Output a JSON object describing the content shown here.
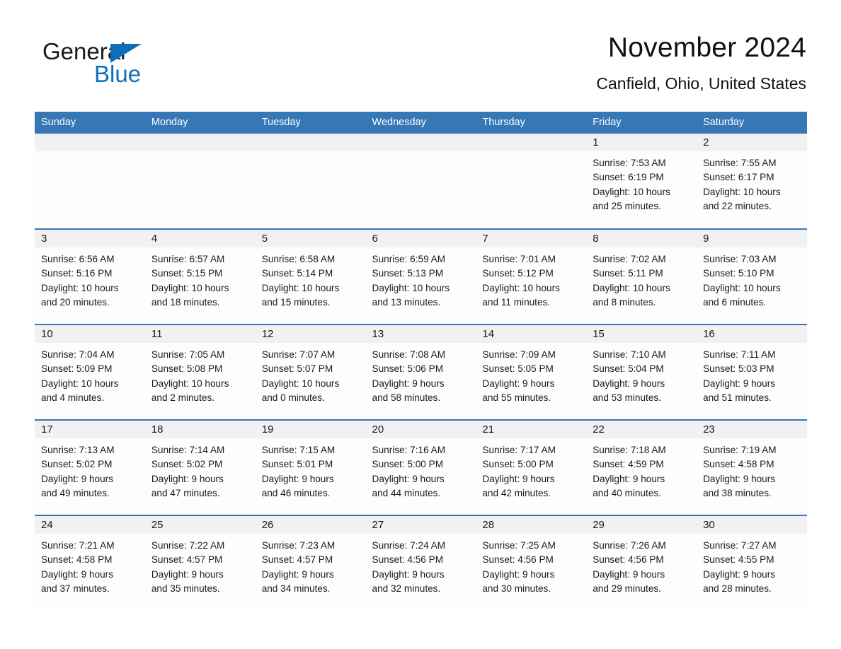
{
  "logo": {
    "word1": "General",
    "word2": "Blue",
    "triangle_color": "#0d6fba"
  },
  "header": {
    "title": "November 2024",
    "subtitle": "Canfield, Ohio, United States"
  },
  "theme": {
    "header_blue": "#3677b5",
    "daynum_band": "#f1f1f1",
    "text": "#1a1a1a"
  },
  "calendar": {
    "weekday_headers": [
      "Sunday",
      "Monday",
      "Tuesday",
      "Wednesday",
      "Thursday",
      "Friday",
      "Saturday"
    ],
    "weeks": [
      [
        {
          "day": "",
          "sunrise": "",
          "sunset": "",
          "daylight_1": "",
          "daylight_2": ""
        },
        {
          "day": "",
          "sunrise": "",
          "sunset": "",
          "daylight_1": "",
          "daylight_2": ""
        },
        {
          "day": "",
          "sunrise": "",
          "sunset": "",
          "daylight_1": "",
          "daylight_2": ""
        },
        {
          "day": "",
          "sunrise": "",
          "sunset": "",
          "daylight_1": "",
          "daylight_2": ""
        },
        {
          "day": "",
          "sunrise": "",
          "sunset": "",
          "daylight_1": "",
          "daylight_2": ""
        },
        {
          "day": "1",
          "sunrise": "Sunrise: 7:53 AM",
          "sunset": "Sunset: 6:19 PM",
          "daylight_1": "Daylight: 10 hours",
          "daylight_2": "and 25 minutes."
        },
        {
          "day": "2",
          "sunrise": "Sunrise: 7:55 AM",
          "sunset": "Sunset: 6:17 PM",
          "daylight_1": "Daylight: 10 hours",
          "daylight_2": "and 22 minutes."
        }
      ],
      [
        {
          "day": "3",
          "sunrise": "Sunrise: 6:56 AM",
          "sunset": "Sunset: 5:16 PM",
          "daylight_1": "Daylight: 10 hours",
          "daylight_2": "and 20 minutes."
        },
        {
          "day": "4",
          "sunrise": "Sunrise: 6:57 AM",
          "sunset": "Sunset: 5:15 PM",
          "daylight_1": "Daylight: 10 hours",
          "daylight_2": "and 18 minutes."
        },
        {
          "day": "5",
          "sunrise": "Sunrise: 6:58 AM",
          "sunset": "Sunset: 5:14 PM",
          "daylight_1": "Daylight: 10 hours",
          "daylight_2": "and 15 minutes."
        },
        {
          "day": "6",
          "sunrise": "Sunrise: 6:59 AM",
          "sunset": "Sunset: 5:13 PM",
          "daylight_1": "Daylight: 10 hours",
          "daylight_2": "and 13 minutes."
        },
        {
          "day": "7",
          "sunrise": "Sunrise: 7:01 AM",
          "sunset": "Sunset: 5:12 PM",
          "daylight_1": "Daylight: 10 hours",
          "daylight_2": "and 11 minutes."
        },
        {
          "day": "8",
          "sunrise": "Sunrise: 7:02 AM",
          "sunset": "Sunset: 5:11 PM",
          "daylight_1": "Daylight: 10 hours",
          "daylight_2": "and 8 minutes."
        },
        {
          "day": "9",
          "sunrise": "Sunrise: 7:03 AM",
          "sunset": "Sunset: 5:10 PM",
          "daylight_1": "Daylight: 10 hours",
          "daylight_2": "and 6 minutes."
        }
      ],
      [
        {
          "day": "10",
          "sunrise": "Sunrise: 7:04 AM",
          "sunset": "Sunset: 5:09 PM",
          "daylight_1": "Daylight: 10 hours",
          "daylight_2": "and 4 minutes."
        },
        {
          "day": "11",
          "sunrise": "Sunrise: 7:05 AM",
          "sunset": "Sunset: 5:08 PM",
          "daylight_1": "Daylight: 10 hours",
          "daylight_2": "and 2 minutes."
        },
        {
          "day": "12",
          "sunrise": "Sunrise: 7:07 AM",
          "sunset": "Sunset: 5:07 PM",
          "daylight_1": "Daylight: 10 hours",
          "daylight_2": "and 0 minutes."
        },
        {
          "day": "13",
          "sunrise": "Sunrise: 7:08 AM",
          "sunset": "Sunset: 5:06 PM",
          "daylight_1": "Daylight: 9 hours",
          "daylight_2": "and 58 minutes."
        },
        {
          "day": "14",
          "sunrise": "Sunrise: 7:09 AM",
          "sunset": "Sunset: 5:05 PM",
          "daylight_1": "Daylight: 9 hours",
          "daylight_2": "and 55 minutes."
        },
        {
          "day": "15",
          "sunrise": "Sunrise: 7:10 AM",
          "sunset": "Sunset: 5:04 PM",
          "daylight_1": "Daylight: 9 hours",
          "daylight_2": "and 53 minutes."
        },
        {
          "day": "16",
          "sunrise": "Sunrise: 7:11 AM",
          "sunset": "Sunset: 5:03 PM",
          "daylight_1": "Daylight: 9 hours",
          "daylight_2": "and 51 minutes."
        }
      ],
      [
        {
          "day": "17",
          "sunrise": "Sunrise: 7:13 AM",
          "sunset": "Sunset: 5:02 PM",
          "daylight_1": "Daylight: 9 hours",
          "daylight_2": "and 49 minutes."
        },
        {
          "day": "18",
          "sunrise": "Sunrise: 7:14 AM",
          "sunset": "Sunset: 5:02 PM",
          "daylight_1": "Daylight: 9 hours",
          "daylight_2": "and 47 minutes."
        },
        {
          "day": "19",
          "sunrise": "Sunrise: 7:15 AM",
          "sunset": "Sunset: 5:01 PM",
          "daylight_1": "Daylight: 9 hours",
          "daylight_2": "and 46 minutes."
        },
        {
          "day": "20",
          "sunrise": "Sunrise: 7:16 AM",
          "sunset": "Sunset: 5:00 PM",
          "daylight_1": "Daylight: 9 hours",
          "daylight_2": "and 44 minutes."
        },
        {
          "day": "21",
          "sunrise": "Sunrise: 7:17 AM",
          "sunset": "Sunset: 5:00 PM",
          "daylight_1": "Daylight: 9 hours",
          "daylight_2": "and 42 minutes."
        },
        {
          "day": "22",
          "sunrise": "Sunrise: 7:18 AM",
          "sunset": "Sunset: 4:59 PM",
          "daylight_1": "Daylight: 9 hours",
          "daylight_2": "and 40 minutes."
        },
        {
          "day": "23",
          "sunrise": "Sunrise: 7:19 AM",
          "sunset": "Sunset: 4:58 PM",
          "daylight_1": "Daylight: 9 hours",
          "daylight_2": "and 38 minutes."
        }
      ],
      [
        {
          "day": "24",
          "sunrise": "Sunrise: 7:21 AM",
          "sunset": "Sunset: 4:58 PM",
          "daylight_1": "Daylight: 9 hours",
          "daylight_2": "and 37 minutes."
        },
        {
          "day": "25",
          "sunrise": "Sunrise: 7:22 AM",
          "sunset": "Sunset: 4:57 PM",
          "daylight_1": "Daylight: 9 hours",
          "daylight_2": "and 35 minutes."
        },
        {
          "day": "26",
          "sunrise": "Sunrise: 7:23 AM",
          "sunset": "Sunset: 4:57 PM",
          "daylight_1": "Daylight: 9 hours",
          "daylight_2": "and 34 minutes."
        },
        {
          "day": "27",
          "sunrise": "Sunrise: 7:24 AM",
          "sunset": "Sunset: 4:56 PM",
          "daylight_1": "Daylight: 9 hours",
          "daylight_2": "and 32 minutes."
        },
        {
          "day": "28",
          "sunrise": "Sunrise: 7:25 AM",
          "sunset": "Sunset: 4:56 PM",
          "daylight_1": "Daylight: 9 hours",
          "daylight_2": "and 30 minutes."
        },
        {
          "day": "29",
          "sunrise": "Sunrise: 7:26 AM",
          "sunset": "Sunset: 4:56 PM",
          "daylight_1": "Daylight: 9 hours",
          "daylight_2": "and 29 minutes."
        },
        {
          "day": "30",
          "sunrise": "Sunrise: 7:27 AM",
          "sunset": "Sunset: 4:55 PM",
          "daylight_1": "Daylight: 9 hours",
          "daylight_2": "and 28 minutes."
        }
      ]
    ]
  }
}
